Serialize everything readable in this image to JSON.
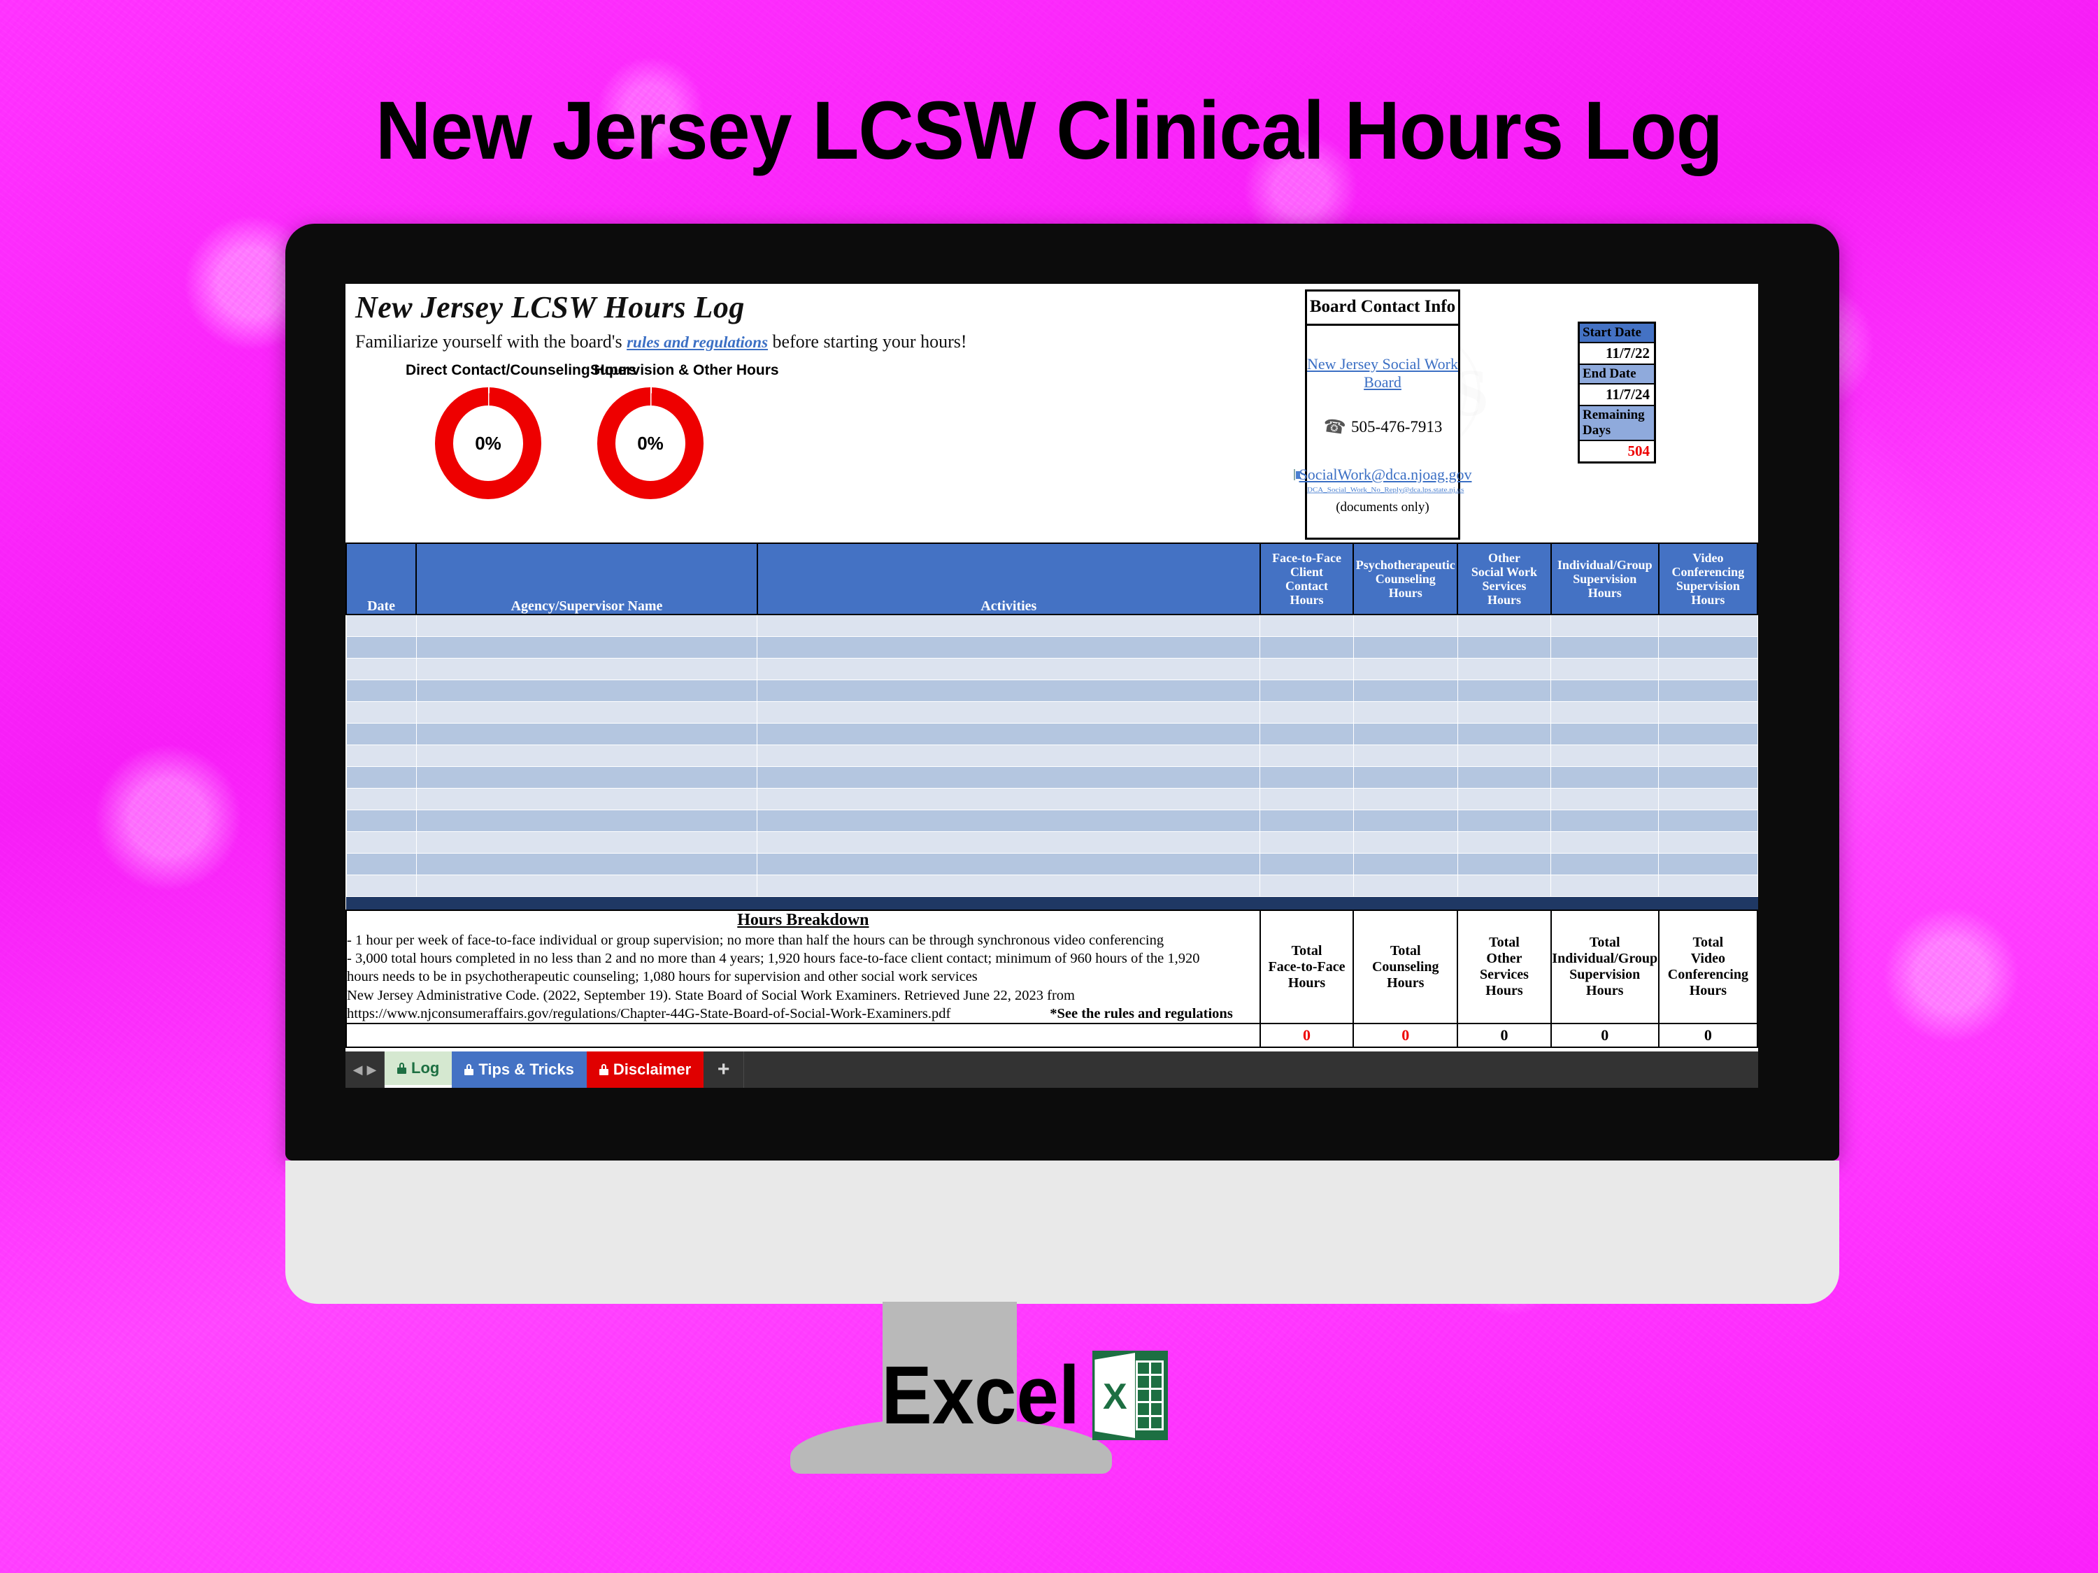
{
  "poster": {
    "title": "New Jersey LCSW Clinical Hours Log",
    "brand": "Excel",
    "brand_icon_letter": "X"
  },
  "sheet": {
    "title": "New Jersey LCSW Hours Log",
    "subline_before": "Familiarize yourself with the board's ",
    "subline_link": "rules and regulations",
    "subline_after": " before starting your hours!",
    "watermark": "CHS"
  },
  "gauges": [
    {
      "label": "Direct Contact/Counseling Hours",
      "value": "0%"
    },
    {
      "label": "Supervision & Other Hours",
      "value": "0%"
    }
  ],
  "contact": {
    "header": "Board Contact Info",
    "board_link": "New Jersey Social Work Board",
    "phone": "505-476-7913",
    "phone_icon": "phone-icon",
    "email": "SocialWork@dca.njoag.gov",
    "email_icon": "envelope-icon",
    "alt_email": "DCA_Social_Work_No_Reply@dca.lps.state.nj.us",
    "note": "(documents only)"
  },
  "dates": {
    "start_label": "Start Date",
    "start_value": "11/7/22",
    "end_label": "End Date",
    "end_value": "11/7/24",
    "remaining_label": "Remaining Days",
    "remaining_value": "504"
  },
  "table": {
    "headers": [
      "Date",
      "Agency/Supervisor Name",
      "Activities",
      "Face-to-Face Client Contact Hours",
      "Psychotherapeutic Counseling Hours",
      "Other Social Work Services Hours",
      "Individual/Group Supervision Hours",
      "Video Conferencing Supervision Hours"
    ],
    "headers_multiline": [
      [
        "Date"
      ],
      [
        "Agency/Supervisor Name"
      ],
      [
        "Activities"
      ],
      [
        "Face-to-Face",
        "Client",
        "Contact",
        "Hours"
      ],
      [
        "Psychotherapeutic",
        "Counseling",
        "Hours"
      ],
      [
        "Other",
        "Social Work",
        "Services",
        "Hours"
      ],
      [
        "Individual/Group",
        "Supervision",
        "Hours"
      ],
      [
        "Video",
        "Conferencing",
        "Supervision",
        "Hours"
      ]
    ],
    "row_count": 13,
    "rows": []
  },
  "breakdown": {
    "title": "Hours Breakdown",
    "lines": [
      "- 1 hour per week of face-to-face individual or group supervision; no more than half the hours can be through synchronous video conferencing",
      "- 3,000 total hours completed in no less than 2 and no more than 4 years; 1,920 hours face-to-face client contact; minimum of 960 hours of the 1,920",
      "hours needs to be in psychotherapeutic counseling; 1,080 hours for supervision and other social work services",
      "New Jersey Administrative Code. (2022, September 19). State Board of Social Work Examiners. Retrieved June 22, 2023 from",
      "https://www.njconsumeraffairs.gov/regulations/Chapter-44G-State-Board-of-Social-Work-Examiners.pdf"
    ],
    "footnote": "*See the rules and regulations"
  },
  "totals": {
    "headers": [
      [
        "Total",
        "Face-to-Face",
        "Hours"
      ],
      [
        "Total",
        "Counseling",
        "Hours"
      ],
      [
        "Total",
        "Other",
        "Services",
        "Hours"
      ],
      [
        "Total",
        "Individual/Group",
        "Supervision",
        "Hours"
      ],
      [
        "Total",
        "Video",
        "Conferencing",
        "Hours"
      ]
    ],
    "values": [
      "0",
      "0",
      "0",
      "0",
      "0"
    ],
    "red_flags": [
      true,
      true,
      false,
      false,
      false
    ]
  },
  "tabs": {
    "nav_prev": "◀",
    "nav_next": "▶",
    "items": [
      {
        "label": "Log",
        "active": true
      },
      {
        "label": "Tips & Tricks",
        "active": false
      },
      {
        "label": "Disclaimer",
        "active": false
      }
    ],
    "add_label": "+"
  },
  "colors": {
    "background_magenta": "#e830e8",
    "header_blue": "#4472c4",
    "row_light": "#dce3ef",
    "row_medium": "#b4c6e0",
    "navy_bar": "#1f3864",
    "red": "#ee0000",
    "excel_green": "#1d6f42"
  }
}
